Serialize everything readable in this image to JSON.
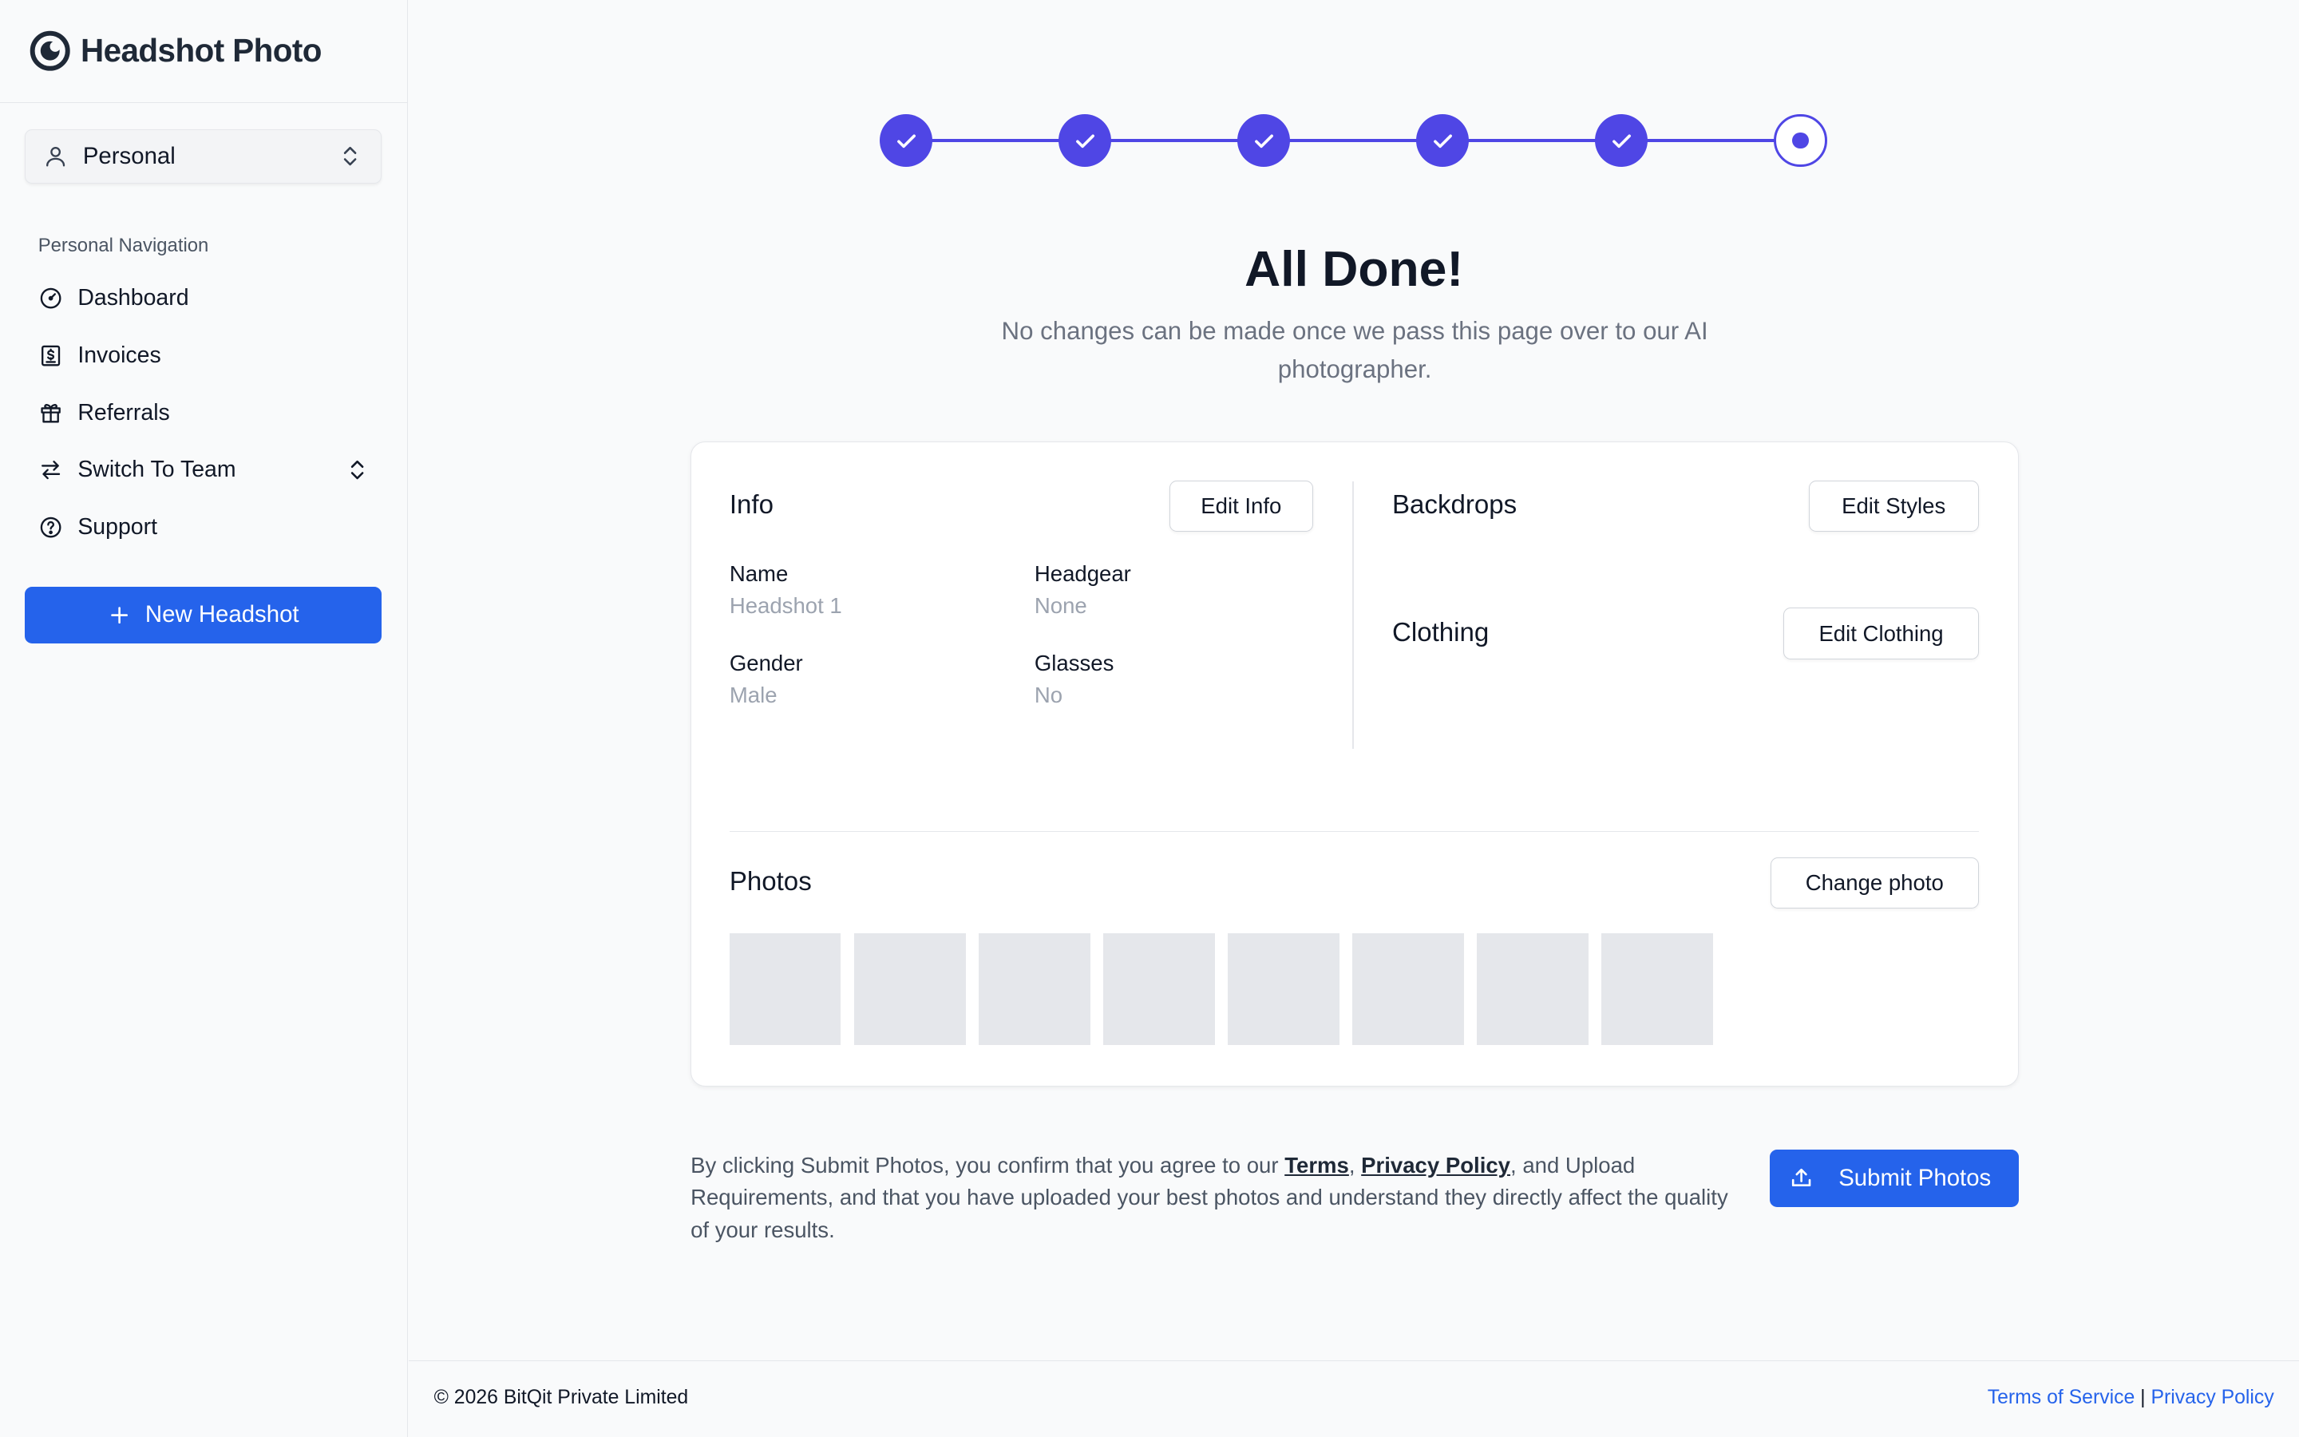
{
  "brand": {
    "name": "Headshot Photo",
    "logo_icon": "headshot-logo-icon"
  },
  "account": {
    "label": "Personal",
    "icon": "user-icon"
  },
  "sidebar": {
    "heading": "Personal Navigation",
    "items": [
      {
        "label": "Dashboard",
        "icon": "gauge-icon"
      },
      {
        "label": "Invoices",
        "icon": "receipt-icon"
      },
      {
        "label": "Referrals",
        "icon": "gift-icon"
      },
      {
        "label": "Switch To Team",
        "icon": "switch-arrows-icon"
      },
      {
        "label": "Support",
        "icon": "help-circle-icon"
      }
    ],
    "new_button": "New Headshot"
  },
  "stepper": {
    "total_steps": 6,
    "completed_steps": 5,
    "current_step": 6,
    "accent": "#4f46e5"
  },
  "main": {
    "title": "All Done!",
    "subtitle": "No changes can be made once we pass this page over to our AI photographer."
  },
  "info": {
    "title": "Info",
    "edit_button": "Edit Info",
    "fields": [
      {
        "label": "Name",
        "value": "Headshot 1"
      },
      {
        "label": "Headgear",
        "value": "None"
      },
      {
        "label": "Gender",
        "value": "Male"
      },
      {
        "label": "Glasses",
        "value": "No"
      }
    ]
  },
  "backdrops": {
    "title": "Backdrops",
    "edit_button": "Edit Styles"
  },
  "clothing": {
    "title": "Clothing",
    "edit_button": "Edit Clothing"
  },
  "photos": {
    "title": "Photos",
    "change_button": "Change photo",
    "placeholder_count": 8
  },
  "agreement": {
    "prefix": "By clicking Submit Photos, you confirm that you agree to our ",
    "terms": "Terms",
    "sep": ",",
    "privacy": "Privacy Policy",
    "suffix": ", and Upload Requirements, and that you have uploaded your best photos and understand they directly affect the quality of your results."
  },
  "submit_button": "Submit Photos",
  "footer": {
    "copyright": "© 2026 BitQit Private Limited",
    "terms": "Terms of Service",
    "separator": "|",
    "privacy": "Privacy Policy"
  },
  "colors": {
    "primary": "#2563eb",
    "stepper": "#4f46e5",
    "muted_text": "#9ca3af"
  }
}
